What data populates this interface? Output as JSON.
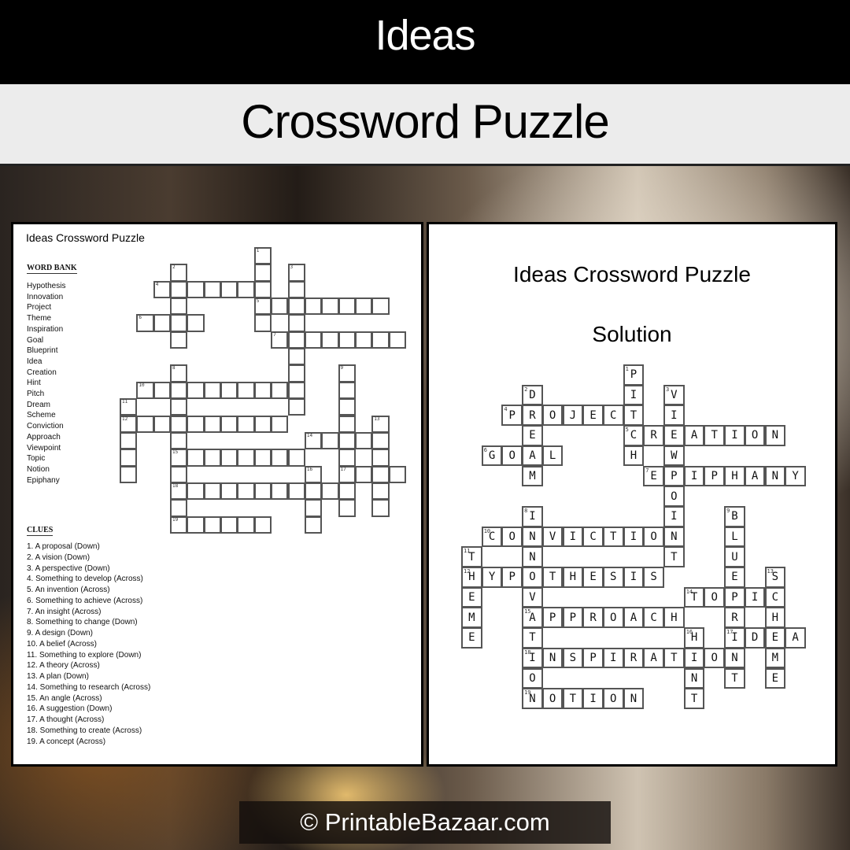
{
  "header": {
    "title": "Ideas",
    "subtitle": "Crossword Puzzle"
  },
  "puzzle_page": {
    "title": "Ideas Crossword Puzzle",
    "word_bank_heading": "WORD BANK",
    "word_bank": [
      "Hypothesis",
      "Innovation",
      "Project",
      "Theme",
      "Inspiration",
      "Goal",
      "Blueprint",
      "Idea",
      "Creation",
      "Hint",
      "Pitch",
      "Dream",
      "Scheme",
      "Conviction",
      "Approach",
      "Viewpoint",
      "Topic",
      "Notion",
      "Epiphany"
    ],
    "clues_heading": "CLUES",
    "clues": [
      "1. A proposal (Down)",
      "2. A vision (Down)",
      "3. A perspective (Down)",
      "4. Something to develop (Across)",
      "5. An invention (Across)",
      "6. Something to achieve (Across)",
      "7. An insight (Across)",
      "8. Something to change (Down)",
      "9. A design (Down)",
      "10. A belief (Across)",
      "11. Something to explore (Down)",
      "12. A theory (Across)",
      "13. A plan (Down)",
      "14. Something to research (Across)",
      "15. An angle (Across)",
      "16. A suggestion (Down)",
      "17. A thought (Across)",
      "18. Something to create (Across)",
      "19. A concept (Across)"
    ]
  },
  "solution_page": {
    "title": "Ideas Crossword Puzzle",
    "subtitle": "Solution"
  },
  "crossword": {
    "entries": [
      {
        "num": 1,
        "answer": "PITCH",
        "dir": "down",
        "col": 8,
        "row": 0
      },
      {
        "num": 2,
        "answer": "DREAM",
        "dir": "down",
        "col": 3,
        "row": 1
      },
      {
        "num": 3,
        "answer": "VIEWPOINT",
        "dir": "down",
        "col": 10,
        "row": 1
      },
      {
        "num": 4,
        "answer": "PROJECT",
        "dir": "across",
        "col": 2,
        "row": 2
      },
      {
        "num": 5,
        "answer": "CREATION",
        "dir": "across",
        "col": 8,
        "row": 3
      },
      {
        "num": 6,
        "answer": "GOAL",
        "dir": "across",
        "col": 1,
        "row": 4
      },
      {
        "num": 7,
        "answer": "EPIPHANY",
        "dir": "across",
        "col": 9,
        "row": 5
      },
      {
        "num": 8,
        "answer": "INNOVATION",
        "dir": "down",
        "col": 3,
        "row": 7
      },
      {
        "num": 9,
        "answer": "BLUEPRINT",
        "dir": "down",
        "col": 13,
        "row": 7
      },
      {
        "num": 10,
        "answer": "CONVICTION",
        "dir": "across",
        "col": 1,
        "row": 8
      },
      {
        "num": 11,
        "answer": "THEME",
        "dir": "down",
        "col": 0,
        "row": 9
      },
      {
        "num": 12,
        "answer": "HYPOTHESIS",
        "dir": "across",
        "col": 0,
        "row": 10
      },
      {
        "num": 13,
        "answer": "SCHEME",
        "dir": "down",
        "col": 15,
        "row": 10
      },
      {
        "num": 14,
        "answer": "TOPIC",
        "dir": "across",
        "col": 11,
        "row": 11
      },
      {
        "num": 15,
        "answer": "APPROACH",
        "dir": "across",
        "col": 3,
        "row": 12
      },
      {
        "num": 16,
        "answer": "HINT",
        "dir": "down",
        "col": 11,
        "row": 13
      },
      {
        "num": 17,
        "answer": "IDEA",
        "dir": "across",
        "col": 13,
        "row": 13
      },
      {
        "num": 18,
        "answer": "INSPIRATION",
        "dir": "across",
        "col": 3,
        "row": 14
      },
      {
        "num": 19,
        "answer": "NOTION",
        "dir": "across",
        "col": 3,
        "row": 16
      }
    ]
  },
  "footer": {
    "copyright": "© PrintableBazaar.com"
  }
}
